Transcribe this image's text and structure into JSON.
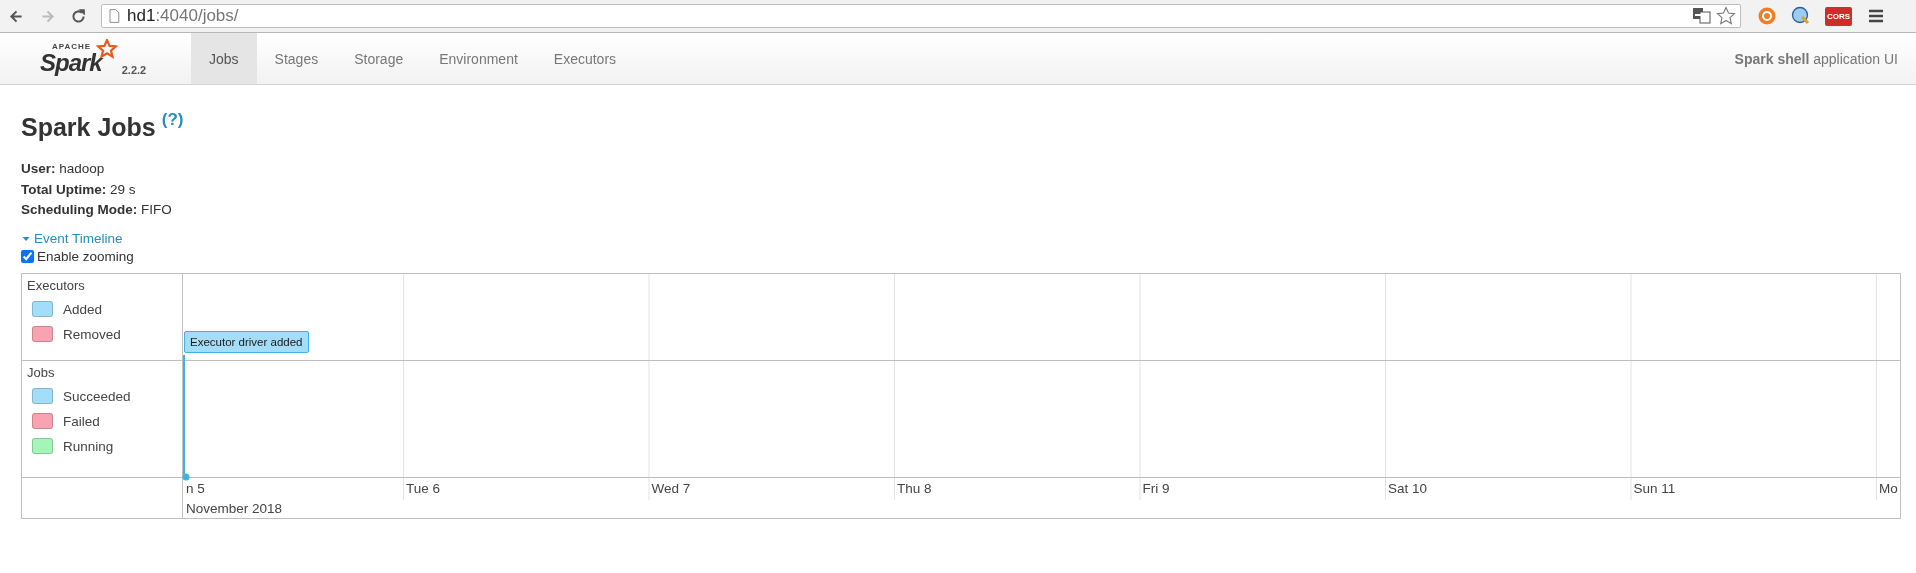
{
  "browser": {
    "back": {
      "disabled": false
    },
    "forward": {
      "disabled": true
    },
    "url_host": "hd1",
    "url_rest": ":4040/jobs/",
    "extensions": [
      {
        "kind": "translate"
      },
      {
        "kind": "star"
      },
      {
        "kind": "orange-circle"
      },
      {
        "kind": "globe"
      },
      {
        "kind": "badge",
        "label": "CORS"
      },
      {
        "kind": "menu"
      }
    ]
  },
  "navbar": {
    "logo": {
      "small": "APACHE",
      "name": "Spark",
      "version": "2.2.2"
    },
    "tabs": [
      {
        "label": "Jobs",
        "selected": true
      },
      {
        "label": "Stages",
        "selected": false
      },
      {
        "label": "Storage",
        "selected": false
      },
      {
        "label": "Environment",
        "selected": false
      },
      {
        "label": "Executors",
        "selected": false
      }
    ],
    "app_name": "**Spark shell** application UI"
  },
  "title": "Spark Jobs",
  "help": "(?)",
  "info": [
    "**User:** hadoop",
    "**Total Uptime:** 29 s",
    "**Scheduling Mode:** FIFO"
  ],
  "timeline_toggle": {
    "label": "Event Timeline",
    "expanded": true
  },
  "zoom_checkbox": {
    "label": "Enable zooming",
    "checked": true
  },
  "timeline": {
    "groups": [
      {
        "title": "Executors",
        "legend": [
          {
            "label": "Added",
            "color": "#a3ddf9"
          },
          {
            "label": "Removed",
            "color": "#f8a3b0"
          }
        ]
      },
      {
        "title": "Jobs",
        "legend": [
          {
            "label": "Succeeded",
            "color": "#a3ddf9"
          },
          {
            "label": "Failed",
            "color": "#f8a3b0"
          },
          {
            "label": "Running",
            "color": "#a3f5b8"
          }
        ]
      }
    ],
    "events": [
      {
        "label": "Executor driver added",
        "color": "#a3ddf9"
      }
    ],
    "ticks": [
      "n 5",
      "Tue 6",
      "Wed 7",
      "Thu 8",
      "Fri 9",
      "Sat 10",
      "Sun 11",
      "Mo"
    ],
    "month": "November 2018"
  }
}
